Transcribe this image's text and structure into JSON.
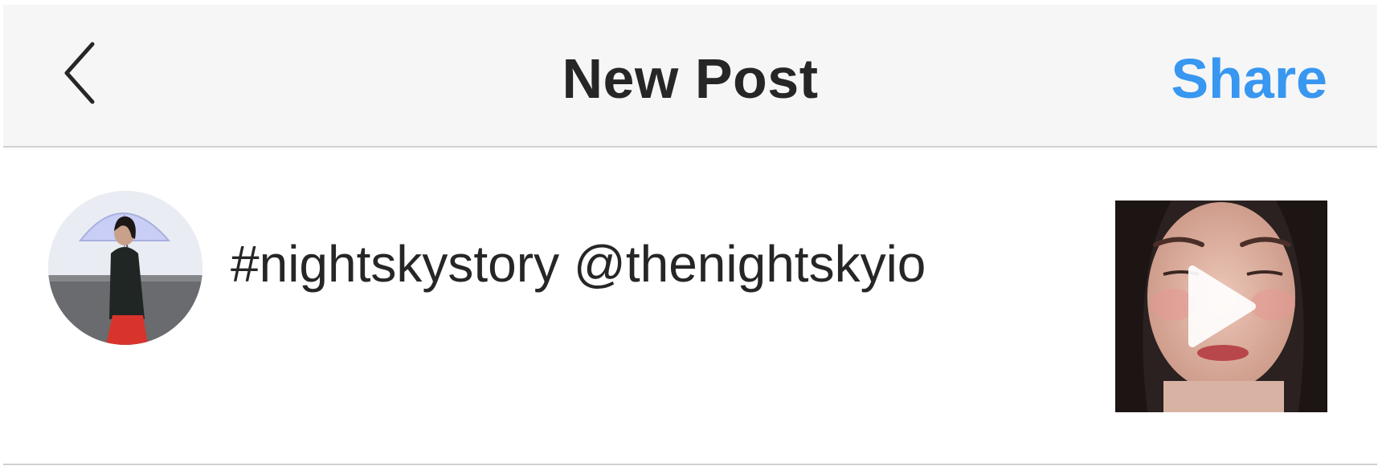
{
  "navbar": {
    "back_icon": "chevron-left-icon",
    "title": "New Post",
    "share_label": "Share",
    "share_color": "#3897f0"
  },
  "composer": {
    "avatar_icon": "user-avatar",
    "caption": "#nightskystory @thenightskyio",
    "thumbnail_icon": "video-thumbnail",
    "play_icon": "play-icon"
  }
}
